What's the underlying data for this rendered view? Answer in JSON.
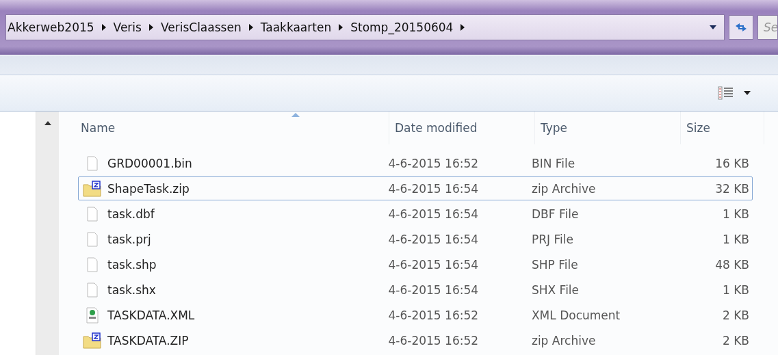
{
  "address_bar": {
    "path": [
      "Akkerweb2015",
      "Veris",
      "VerisClaassen",
      "Taakkaarten",
      "Stomp_20150604"
    ]
  },
  "search": {
    "placeholder": "Se"
  },
  "table": {
    "columns": [
      {
        "label": "Name",
        "sorted": true
      },
      {
        "label": "Date modified",
        "sorted": false
      },
      {
        "label": "Type",
        "sorted": false
      },
      {
        "label": "Size",
        "sorted": false
      }
    ],
    "rows": [
      {
        "kind": "file",
        "name": "GRD00001.bin",
        "date": "4-6-2015 16:52",
        "type": "BIN File",
        "size": "16 KB",
        "focused": false
      },
      {
        "kind": "zip",
        "name": "ShapeTask.zip",
        "date": "4-6-2015 16:54",
        "type": "zip Archive",
        "size": "32 KB",
        "focused": true
      },
      {
        "kind": "file",
        "name": "task.dbf",
        "date": "4-6-2015 16:54",
        "type": "DBF File",
        "size": "1 KB",
        "focused": false
      },
      {
        "kind": "file",
        "name": "task.prj",
        "date": "4-6-2015 16:54",
        "type": "PRJ File",
        "size": "1 KB",
        "focused": false
      },
      {
        "kind": "file",
        "name": "task.shp",
        "date": "4-6-2015 16:54",
        "type": "SHP File",
        "size": "48 KB",
        "focused": false
      },
      {
        "kind": "file",
        "name": "task.shx",
        "date": "4-6-2015 16:54",
        "type": "SHX File",
        "size": "1 KB",
        "focused": false
      },
      {
        "kind": "xml",
        "name": "TASKDATA.XML",
        "date": "4-6-2015 16:52",
        "type": "XML Document",
        "size": "2 KB",
        "focused": false
      },
      {
        "kind": "zip",
        "name": "TASKDATA.ZIP",
        "date": "4-6-2015 16:52",
        "type": "zip Archive",
        "size": "2 KB",
        "focused": false
      }
    ]
  }
}
